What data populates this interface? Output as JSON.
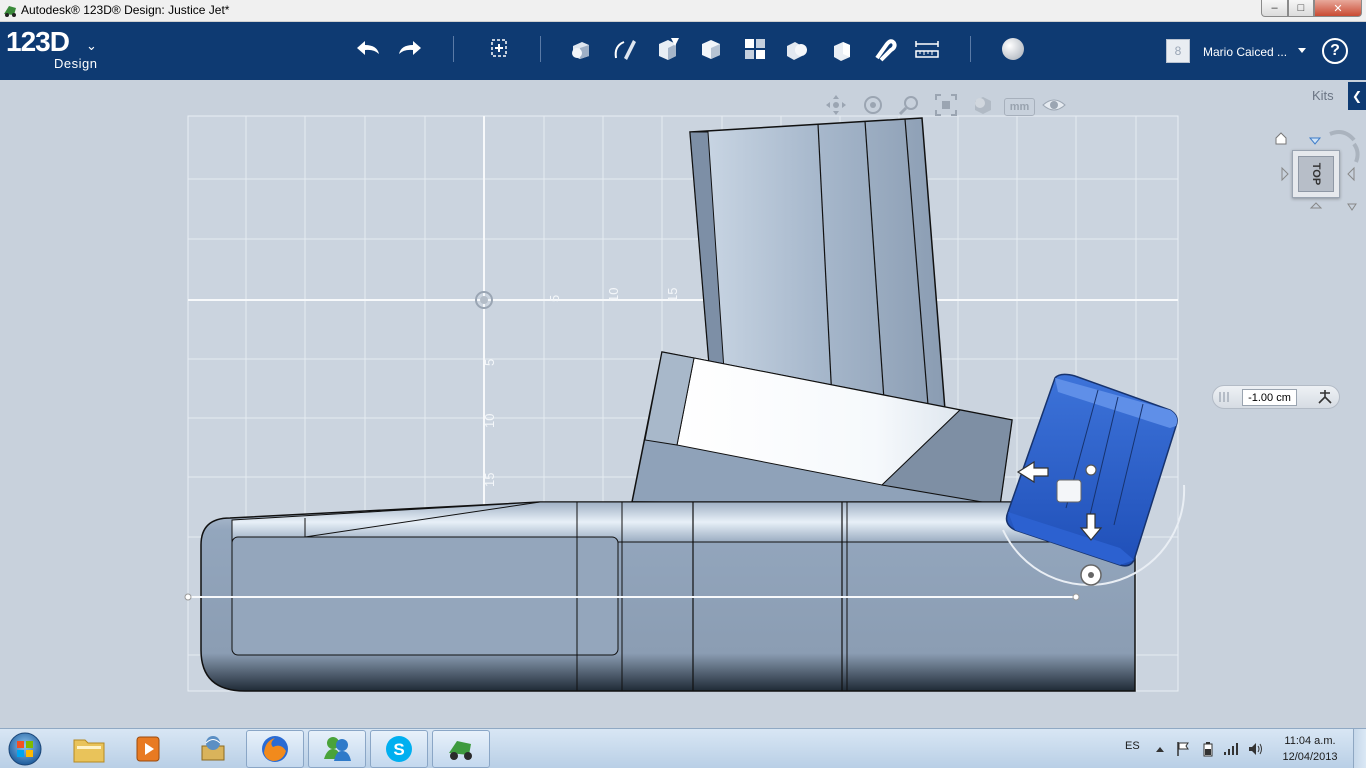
{
  "window": {
    "title": "Autodesk® 123D® Design: Justice Jet*",
    "minimize": "–",
    "maximize": "□",
    "close": "✕"
  },
  "toolbar": {
    "logo_number": "123D",
    "logo_sub": "Design",
    "logo_caret": "⌄",
    "items": [
      {
        "name": "undo-button",
        "icon": "undo-arrow-icon"
      },
      {
        "name": "redo-button",
        "icon": "redo-arrow-icon"
      },
      {
        "name": "transform-button",
        "icon": "transform-icon"
      },
      {
        "name": "primitives-button",
        "icon": "primitives-icon"
      },
      {
        "name": "sketch-button",
        "icon": "sketch-icon"
      },
      {
        "name": "construct-button",
        "icon": "construct-icon"
      },
      {
        "name": "modify-button",
        "icon": "modify-icon"
      },
      {
        "name": "pattern-button",
        "icon": "pattern-icon"
      },
      {
        "name": "grouping-button",
        "icon": "grouping-icon"
      },
      {
        "name": "combine-button",
        "icon": "combine-icon"
      },
      {
        "name": "snap-button",
        "icon": "snap-magnet-icon"
      },
      {
        "name": "measure-button",
        "icon": "ruler-icon"
      },
      {
        "name": "material-button",
        "icon": "sphere-icon"
      }
    ],
    "user_initial": "8",
    "user_name": "Mario Caiced ...",
    "help": "?"
  },
  "viewport": {
    "kits_label": "Kits",
    "kits_tab": "❮",
    "units": "mm",
    "viewcube_face": "TOP",
    "ruler_labels": [
      "5",
      "10",
      "15"
    ],
    "ruler_labels_vertical": [
      "5",
      "10",
      "15"
    ],
    "distance_value": "-1.00 cm"
  },
  "taskbar": {
    "apps": [
      {
        "name": "explorer",
        "icon": "folder-icon"
      },
      {
        "name": "media-player",
        "icon": "media-player-icon"
      },
      {
        "name": "app-3",
        "icon": "archive-icon"
      },
      {
        "name": "firefox",
        "icon": "firefox-icon"
      },
      {
        "name": "messenger",
        "icon": "messenger-icon"
      },
      {
        "name": "skype",
        "icon": "skype-icon"
      },
      {
        "name": "123d",
        "icon": "123d-design-icon"
      }
    ],
    "language": "ES",
    "time": "11:04 a.m.",
    "date": "12/04/2013"
  },
  "colors": {
    "toolbar_bg": "#0e3a72",
    "viewport_bg": "#c8d1dc",
    "selected_part": "#2a5fc9",
    "model_part": "#8ea2ba"
  }
}
